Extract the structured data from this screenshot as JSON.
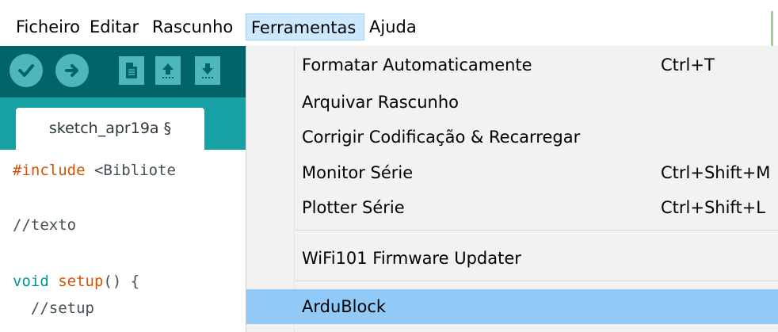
{
  "menubar": {
    "items": [
      {
        "label": "Ficheiro"
      },
      {
        "label": "Editar"
      },
      {
        "label": "Rascunho"
      },
      {
        "label": "Ferramentas"
      },
      {
        "label": "Ajuda"
      }
    ]
  },
  "toolbar": {
    "icons": [
      "check-icon",
      "arrow-right-icon",
      "document-icon",
      "upload-icon",
      "download-icon"
    ]
  },
  "tab": {
    "label": "sketch_apr19a §"
  },
  "editor": {
    "lines": {
      "include_kw": "#include",
      "include_rest": " <Bibliote",
      "comment_texto": "//texto",
      "void_kw": "void",
      "setup_fn": "setup",
      "setup_rest": "() {",
      "comment_setup": "  //setup"
    }
  },
  "dropdown": {
    "items": [
      {
        "label": "Formatar Automaticamente",
        "shortcut": "Ctrl+T"
      },
      {
        "label": "Arquivar Rascunho",
        "shortcut": ""
      },
      {
        "label": "Corrigir Codificação & Recarregar",
        "shortcut": ""
      },
      {
        "label": "Monitor Série",
        "shortcut": "Ctrl+Shift+M"
      },
      {
        "label": "Plotter Série",
        "shortcut": "Ctrl+Shift+L"
      },
      {
        "label": "WiFi101 Firmware Updater",
        "shortcut": ""
      },
      {
        "label": "ArduBlock",
        "shortcut": ""
      }
    ]
  },
  "colors": {
    "toolbar": "#006468",
    "tabstrip": "#17a1a5",
    "button": "#4db7bb",
    "menu_active": "#cce8ff",
    "item_highlight": "#91c9f7"
  }
}
